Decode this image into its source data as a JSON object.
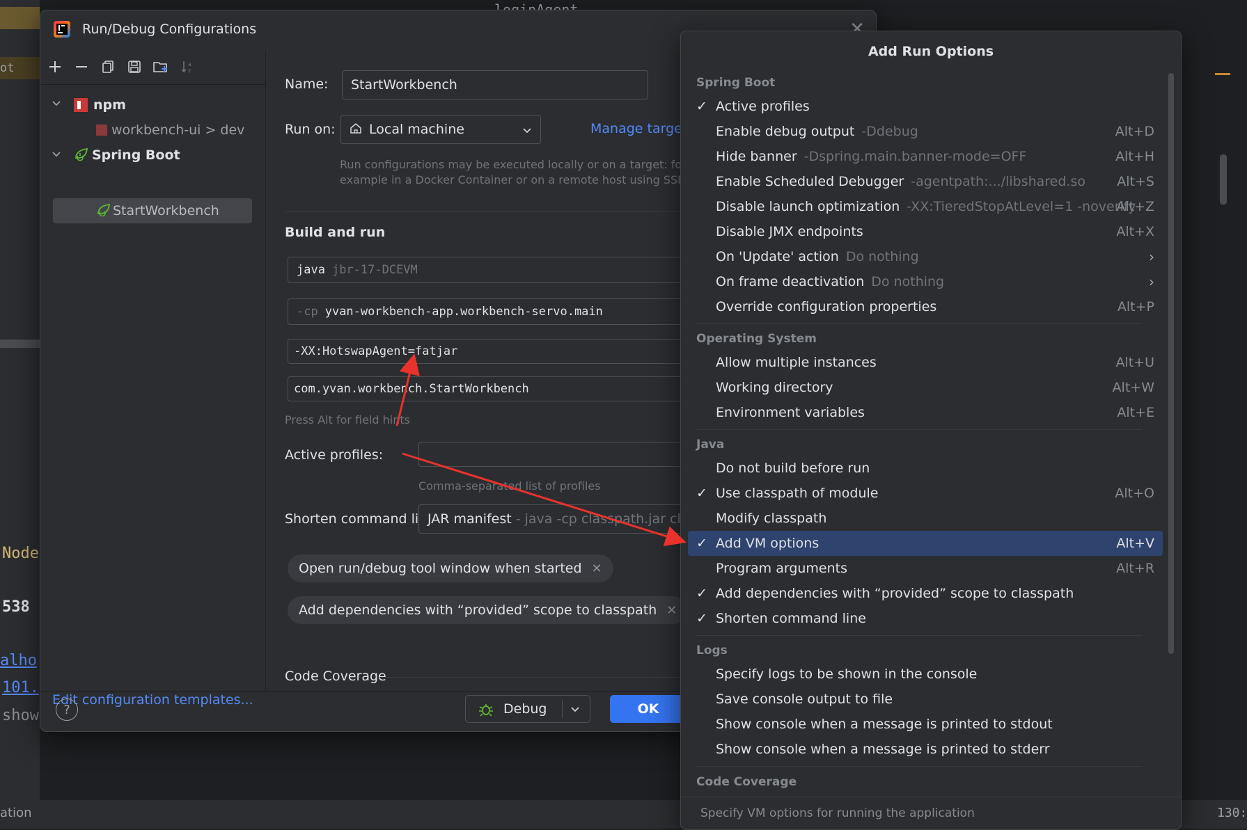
{
  "background": {
    "left_fragments": [
      "ot",
      "Node",
      "538",
      "alho",
      "101.",
      "show",
      "ation"
    ],
    "top_code": "loginAgent",
    "status_right": "130:"
  },
  "dialog": {
    "title": "Run/Debug Configurations",
    "tree": {
      "npm_label": "npm",
      "npm_child": "workbench-ui > dev",
      "spring_label": "Spring Boot",
      "spring_child": "StartWorkbench"
    },
    "edit_templates": "Edit configuration templates...",
    "name_label": "Name:",
    "name_value": "StartWorkbench",
    "run_on_label": "Run on:",
    "run_on_value": "Local machine",
    "manage_targets": "Manage targets...",
    "run_on_hint_1": "Run configurations may be executed locally or on a target: for",
    "run_on_hint_2": "example in a Docker Container or on a remote host using SSH.",
    "build_and_run": "Build and run",
    "java_prefix": "java",
    "java_value": "jbr-17-DCEVM",
    "cp_prefix": "-cp",
    "cp_value": "yvan-workbench-app.workbench-servo.main",
    "vm_options": "-XX:HotswapAgent=fatjar",
    "main_class": "com.yvan.workbench.StartWorkbench",
    "field_hint": "Press Alt for field hints",
    "active_profiles_label": "Active profiles:",
    "active_profiles_hint": "Comma-separated list of profiles",
    "shorten_label": "Shorten command line:",
    "shorten_value": "JAR manifest",
    "shorten_sub": "- java -cp classpath.jar cla",
    "chip_1": "Open run/debug tool window when started",
    "chip_2": "Add dependencies with “provided” scope to classpath",
    "code_coverage": "Code Coverage",
    "debug_button": "Debug",
    "ok_button": "OK"
  },
  "popup": {
    "title": "Add Run Options",
    "groups": {
      "spring_boot": "Spring Boot",
      "operating_system": "Operating System",
      "java": "Java",
      "logs": "Logs",
      "code_coverage": "Code Coverage"
    },
    "items": [
      {
        "label": "Active profiles",
        "sub": "",
        "shortcut": "",
        "checked": true
      },
      {
        "label": "Enable debug output",
        "sub": "-Ddebug",
        "shortcut": "Alt+D",
        "checked": false
      },
      {
        "label": "Hide banner",
        "sub": "-Dspring.main.banner-mode=OFF",
        "shortcut": "Alt+H",
        "checked": false
      },
      {
        "label": "Enable Scheduled Debugger",
        "sub": "-agentpath:.../libshared.so",
        "shortcut": "Alt+S",
        "checked": false
      },
      {
        "label": "Disable launch optimization",
        "sub": "-XX:TieredStopAtLevel=1 -noverify",
        "shortcut": "Alt+Z",
        "checked": false
      },
      {
        "label": "Disable JMX endpoints",
        "sub": "",
        "shortcut": "Alt+X",
        "checked": false
      },
      {
        "label": "On 'Update' action",
        "sub": "Do nothing",
        "shortcut": "",
        "checked": false
      },
      {
        "label": "On frame deactivation",
        "sub": "Do nothing",
        "shortcut": "",
        "checked": false
      },
      {
        "label": "Override configuration properties",
        "sub": "",
        "shortcut": "Alt+P",
        "checked": false
      },
      {
        "label": "Allow multiple instances",
        "sub": "",
        "shortcut": "Alt+U",
        "checked": false
      },
      {
        "label": "Working directory",
        "sub": "",
        "shortcut": "Alt+W",
        "checked": false
      },
      {
        "label": "Environment variables",
        "sub": "",
        "shortcut": "Alt+E",
        "checked": false
      },
      {
        "label": "Do not build before run",
        "sub": "",
        "shortcut": "",
        "checked": false
      },
      {
        "label": "Use classpath of module",
        "sub": "",
        "shortcut": "Alt+O",
        "checked": true
      },
      {
        "label": "Modify classpath",
        "sub": "",
        "shortcut": "",
        "checked": false
      },
      {
        "label": "Add VM options",
        "sub": "",
        "shortcut": "Alt+V",
        "checked": true
      },
      {
        "label": "Program arguments",
        "sub": "",
        "shortcut": "Alt+R",
        "checked": false
      },
      {
        "label": "Add dependencies with “provided” scope to classpath",
        "sub": "",
        "shortcut": "",
        "checked": true
      },
      {
        "label": "Shorten command line",
        "sub": "",
        "shortcut": "",
        "checked": true
      },
      {
        "label": "Specify logs to be shown in the console",
        "sub": "",
        "shortcut": "",
        "checked": false
      },
      {
        "label": "Save console output to file",
        "sub": "",
        "shortcut": "",
        "checked": false
      },
      {
        "label": "Show console when a message is printed to stdout",
        "sub": "",
        "shortcut": "",
        "checked": false
      },
      {
        "label": "Show console when a message is printed to stderr",
        "sub": "",
        "shortcut": "",
        "checked": false
      }
    ],
    "status": "Specify VM options for running the application"
  },
  "colors": {
    "accent": "#3574f0",
    "selection": "#2e436e",
    "link": "#548af7",
    "annotation_arrow": "#e8322b"
  }
}
